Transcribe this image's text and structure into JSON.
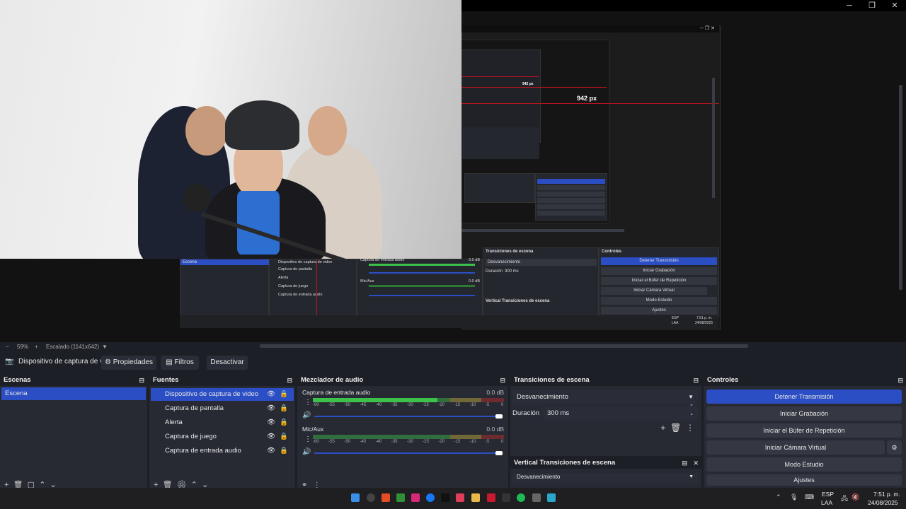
{
  "window": {
    "minimize": "─",
    "restore": "❐",
    "close": "✕"
  },
  "preview": {
    "measure_label_large": "942 px",
    "measure_label_small": "942 px",
    "zoom_minus": "−",
    "zoom_value": "59%",
    "zoom_plus": "+",
    "scale_text": "Escalado (1141x642)",
    "scale_arrow": "▼"
  },
  "nested": {
    "scene": "Escena",
    "sources": [
      "Dispositivo de captura de video",
      "Captura de pantalla",
      "Alerta",
      "Captura de juego",
      "Captura de entrada audio"
    ],
    "audio1": "Captura de entrada audio",
    "audio1_db": "0.0 dB",
    "audio2": "Mic/Aux",
    "audio2_db": "0.0 dB",
    "trans_title": "Transiciones de escena",
    "trans_value": "Desvanecimiento",
    "duration_label": "Duración",
    "duration_value": "300 ms",
    "vtrans_title": "Vertical Transiciones de escena",
    "controls_title": "Controles",
    "controls": [
      "Detener Transmisión",
      "Iniciar Grabación",
      "Iniciar el Búfer de Repetición",
      "Iniciar Cámara Virtual",
      "Modo Estudio",
      "Ajustes"
    ],
    "lang": "ESP",
    "lang2": "LAA",
    "time": "7:51 p. m.",
    "date": "24/08/2025"
  },
  "context": {
    "source_name": "Dispositivo de captura de v",
    "properties": "Propiedades",
    "filters": "Filtros",
    "deactivate": "Desactivar"
  },
  "scenes": {
    "title": "Escenas",
    "items": [
      "Escena"
    ]
  },
  "sources": {
    "title": "Fuentes",
    "items": [
      "Dispositivo de captura de video",
      "Captura de pantalla",
      "Alerta",
      "Captura de juego",
      "Captura de entrada audio"
    ]
  },
  "mixer": {
    "title": "Mezclador de audio",
    "channels": [
      {
        "name": "Captura de entrada audio",
        "db": "0.0 dB",
        "level": 0.65
      },
      {
        "name": "Mic/Aux",
        "db": "0.0 dB",
        "level": 0.0
      }
    ],
    "ticks": [
      "-60",
      "-55",
      "-50",
      "-45",
      "-40",
      "-35",
      "-30",
      "-25",
      "-20",
      "-15",
      "-10",
      "-5",
      "0"
    ]
  },
  "transitions": {
    "title": "Transiciones de escena",
    "selected": "Desvanecimiento",
    "duration_label": "Duración",
    "duration_value": "300 ms",
    "vertical_title": "Vertical Transiciones de escena",
    "vertical_selected": "Desvanecimiento"
  },
  "controls": {
    "title": "Controles",
    "stop_stream": "Detener Transmisión",
    "start_record": "Iniciar Grabación",
    "start_replay": "Iniciar el Búfer de Repetición",
    "start_vcam": "Iniciar Cámara Virtual",
    "studio": "Modo Estudio",
    "settings": "Ajustes"
  },
  "taskbar": {
    "lang": "ESP",
    "lang2": "LAA",
    "time": "7:51 p. m.",
    "date": "24/08/2025"
  },
  "colors": {
    "accent": "#2b4ec4",
    "meter_green": "#3cc24a",
    "meter_yellow": "#c9b43a",
    "meter_red": "#c42b2b"
  }
}
